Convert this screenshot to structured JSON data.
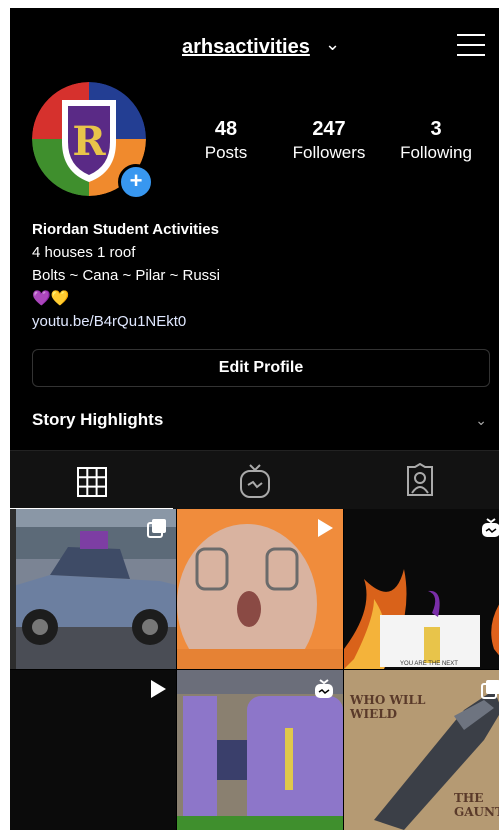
{
  "profile": {
    "username": "arhsactivities",
    "stats": [
      {
        "value": "48",
        "label": "Posts"
      },
      {
        "value": "247",
        "label": "Followers"
      },
      {
        "value": "3",
        "label": "Following"
      }
    ],
    "bio_name": "Riordan Student Activities",
    "bio_lines": [
      "4 houses 1 roof",
      "Bolts ~ Cana ~ Pilar ~ Russi"
    ],
    "emoji": "💜💛",
    "link": "youtu.be/B4rQu1NEkt0",
    "edit_label": "Edit Profile",
    "highlights_label": "Story Highlights"
  },
  "icons": {
    "menu": "hamburger-icon",
    "chevron": "chevron-down-icon",
    "grid": "grid-icon",
    "igtv": "igtv-icon",
    "tagged": "tagged-icon"
  },
  "posts": {
    "captions": {
      "wield_top": "WHO WILL\nWIELD",
      "wield_bottom": "THE\nGAUNTLET"
    }
  },
  "colors": {
    "accent": "#3897f0",
    "background": "#000000"
  }
}
